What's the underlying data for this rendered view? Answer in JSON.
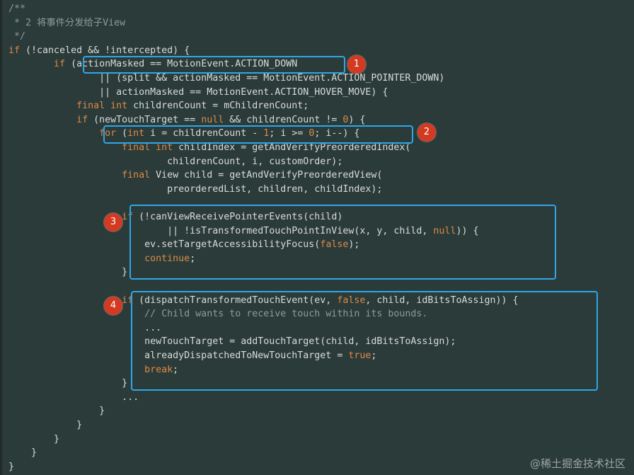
{
  "colors": {
    "background": "#2b3b3a",
    "text": "#d8dcd8",
    "keyword": "#dd8a44",
    "comment": "#8f9a97",
    "highlight_border": "#2ea7e8",
    "badge": "#d23a22"
  },
  "code_lines": [
    [
      {
        "t": "/**",
        "c": "cm"
      }
    ],
    [
      {
        "t": " * 2 将事件分发给子View",
        "c": "cm"
      }
    ],
    [
      {
        "t": " */",
        "c": "cm"
      }
    ],
    [
      {
        "t": "if",
        "c": "kw"
      },
      {
        "t": " (!canceled && !intercepted) {"
      }
    ],
    [
      {
        "t": "        "
      },
      {
        "t": "if",
        "c": "kw"
      },
      {
        "t": " (actionMasked == MotionEvent.ACTION_DOWN"
      }
    ],
    [
      {
        "t": "                || (split && actionMasked == MotionEvent.ACTION_POINTER_DOWN)"
      }
    ],
    [
      {
        "t": "                || actionMasked == MotionEvent.ACTION_HOVER_MOVE) {"
      }
    ],
    [
      {
        "t": "            "
      },
      {
        "t": "final int",
        "c": "kw"
      },
      {
        "t": " childrenCount = mChildrenCount;"
      }
    ],
    [
      {
        "t": "            "
      },
      {
        "t": "if",
        "c": "kw"
      },
      {
        "t": " (newTouchTarget == "
      },
      {
        "t": "null",
        "c": "kw"
      },
      {
        "t": " && childrenCount != "
      },
      {
        "t": "0",
        "c": "kw"
      },
      {
        "t": ") {"
      }
    ],
    [
      {
        "t": "                "
      },
      {
        "t": "for",
        "c": "kw"
      },
      {
        "t": " ("
      },
      {
        "t": "int",
        "c": "kw"
      },
      {
        "t": " i = childrenCount - "
      },
      {
        "t": "1",
        "c": "kw"
      },
      {
        "t": "; i >= "
      },
      {
        "t": "0",
        "c": "kw"
      },
      {
        "t": "; i--) {"
      }
    ],
    [
      {
        "t": "                    "
      },
      {
        "t": "final int",
        "c": "kw"
      },
      {
        "t": " childIndex = getAndVerifyPreorderedIndex("
      }
    ],
    [
      {
        "t": "                            childrenCount, i, customOrder);"
      }
    ],
    [
      {
        "t": "                    "
      },
      {
        "t": "final",
        "c": "kw"
      },
      {
        "t": " View child = getAndVerifyPreorderedView("
      }
    ],
    [
      {
        "t": "                            preorderedList, children, childIndex);"
      }
    ],
    [
      {
        "t": ""
      }
    ],
    [
      {
        "t": "                    "
      },
      {
        "t": "if",
        "c": "kw"
      },
      {
        "t": " (!canViewReceivePointerEvents(child)"
      }
    ],
    [
      {
        "t": "                            || !isTransformedTouchPointInView(x, y, child, "
      },
      {
        "t": "null",
        "c": "kw"
      },
      {
        "t": ")) {"
      }
    ],
    [
      {
        "t": "                        ev.setTargetAccessibilityFocus("
      },
      {
        "t": "false",
        "c": "kw"
      },
      {
        "t": ");"
      }
    ],
    [
      {
        "t": "                        "
      },
      {
        "t": "continue",
        "c": "kw"
      },
      {
        "t": ";"
      }
    ],
    [
      {
        "t": "                    }"
      }
    ],
    [
      {
        "t": ""
      }
    ],
    [
      {
        "t": "                    "
      },
      {
        "t": "if",
        "c": "kw"
      },
      {
        "t": " (dispatchTransformedTouchEvent(ev, "
      },
      {
        "t": "false",
        "c": "kw"
      },
      {
        "t": ", child, idBitsToAssign)) {"
      }
    ],
    [
      {
        "t": "                        // Child wants to receive touch within its bounds.",
        "c": "cm"
      }
    ],
    [
      {
        "t": "                        ..."
      }
    ],
    [
      {
        "t": "                        newTouchTarget = addTouchTarget(child, idBitsToAssign);"
      }
    ],
    [
      {
        "t": "                        alreadyDispatchedToNewTouchTarget = "
      },
      {
        "t": "true",
        "c": "kw"
      },
      {
        "t": ";"
      }
    ],
    [
      {
        "t": "                        "
      },
      {
        "t": "break",
        "c": "kw"
      },
      {
        "t": ";"
      }
    ],
    [
      {
        "t": "                    }"
      }
    ],
    [
      {
        "t": "                    ..."
      }
    ],
    [
      {
        "t": "                }"
      }
    ],
    [
      {
        "t": "            }"
      }
    ],
    [
      {
        "t": "        }"
      }
    ],
    [
      {
        "t": "    }"
      }
    ],
    [
      {
        "t": "}"
      }
    ]
  ],
  "badges": [
    "1",
    "2",
    "3",
    "4"
  ],
  "watermark": "@稀土掘金技术社区"
}
